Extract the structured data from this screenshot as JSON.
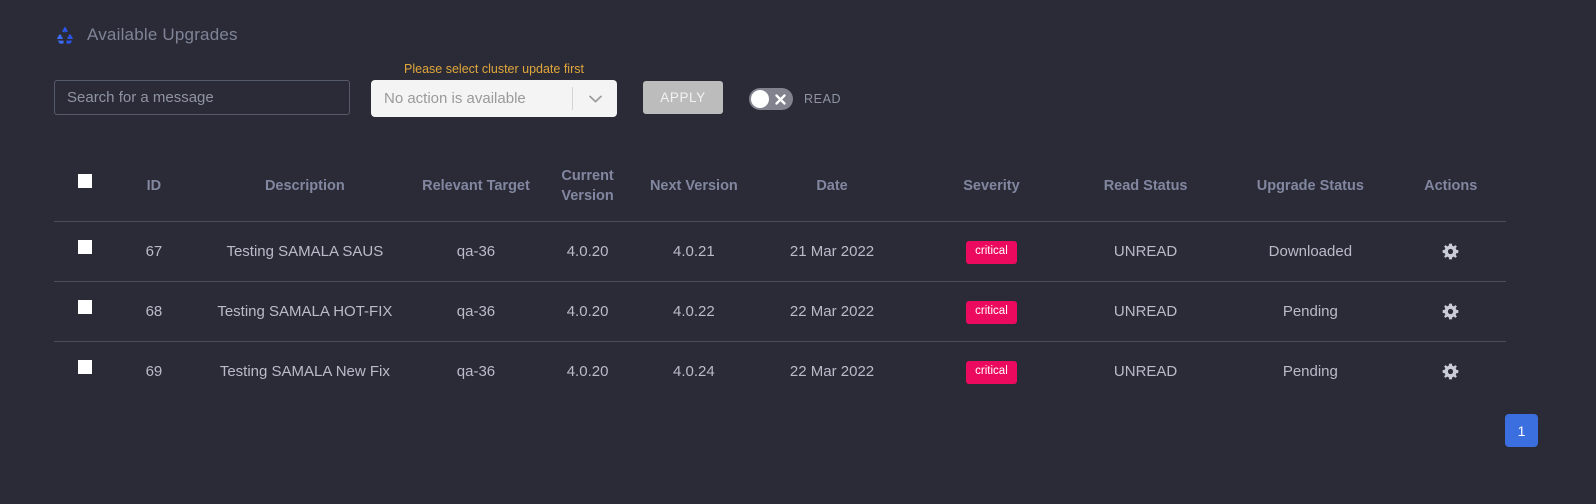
{
  "header": {
    "title": "Available Upgrades",
    "icon": "recycle-icon"
  },
  "toolbar": {
    "search_placeholder": "Search for a message",
    "search_value": "",
    "select_warning": "Please select cluster update first",
    "select_value": "No action is available",
    "apply_label": "APPLY",
    "read_toggle_label": "READ",
    "read_toggle_state": "off"
  },
  "table": {
    "headers": {
      "id": "ID",
      "description": "Description",
      "relevant_target": "Relevant Target",
      "current_version": "Current Version",
      "next_version": "Next Version",
      "date": "Date",
      "severity": "Severity",
      "read_status": "Read Status",
      "upgrade_status": "Upgrade Status",
      "actions": "Actions"
    },
    "rows": [
      {
        "id": "67",
        "description": "Testing SAMALA SAUS",
        "relevant_target": "qa-36",
        "current_version": "4.0.20",
        "next_version": "4.0.21",
        "date": "21 Mar 2022",
        "severity": "critical",
        "read_status": "UNREAD",
        "upgrade_status": "Downloaded",
        "action_icon": "gear-icon"
      },
      {
        "id": "68",
        "description": "Testing SAMALA HOT-FIX",
        "relevant_target": "qa-36",
        "current_version": "4.0.20",
        "next_version": "4.0.22",
        "date": "22 Mar 2022",
        "severity": "critical",
        "read_status": "UNREAD",
        "upgrade_status": "Pending",
        "action_icon": "gear-icon"
      },
      {
        "id": "69",
        "description": "Testing SAMALA New Fix",
        "relevant_target": "qa-36",
        "current_version": "4.0.20",
        "next_version": "4.0.24",
        "date": "22 Mar 2022",
        "severity": "critical",
        "read_status": "UNREAD",
        "upgrade_status": "Pending",
        "action_icon": "gear-icon"
      }
    ]
  },
  "pagination": {
    "current_page": "1"
  },
  "colors": {
    "background": "#2b2b38",
    "severity_badge": "#ec0a5e",
    "pagination_active": "#3b6fe0",
    "warning_text": "#e0a63a",
    "header_icon": "#2b56e8"
  }
}
